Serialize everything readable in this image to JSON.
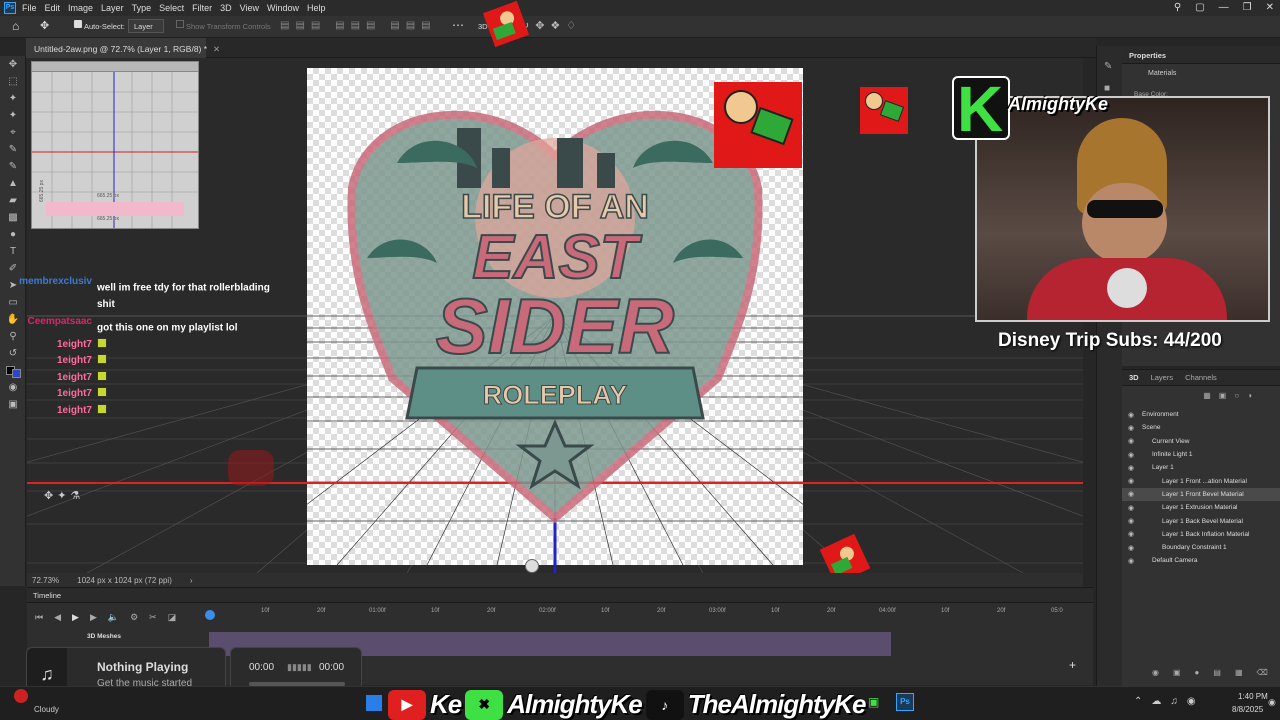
{
  "menubar": {
    "app_icon": "Ps",
    "items": [
      "File",
      "Edit",
      "Image",
      "Layer",
      "Type",
      "Select",
      "Filter",
      "3D",
      "View",
      "Window",
      "Help"
    ]
  },
  "options": {
    "auto_select_label": "Auto-Select:",
    "auto_select_value": "Layer",
    "show_transform": "Show Transform Controls",
    "mode_3d_label": "3D Mode:"
  },
  "document": {
    "tab_title": "Untitled-2aw.png @ 72.7% (Layer 1, RGB/8) *",
    "zoom": "72.73%",
    "size": "1024 px x 1024 px (72 ppi)",
    "ruler_text_top": "665.25 px",
    "ruler_text_bottom": "665.25 px",
    "ruler_text_side": "665.25 px"
  },
  "logo": {
    "line1": "LIFE OF AN",
    "line2": "EAST",
    "line3": "SIDER",
    "line4": "ROLEPLAY"
  },
  "chat": [
    {
      "user": "membrexclusiv",
      "text": "well im free tdy for that rollerblading",
      "user_color": "#3a7bd5"
    },
    {
      "user": "",
      "text": "shit",
      "user_color": "#3a7bd5"
    },
    {
      "user": "Ceempatsaac",
      "text": "got this one on my playlist lol",
      "user_color": "#e0246a"
    },
    {
      "user": "1eight7",
      "text": "",
      "user_color": "#ff6b9d"
    },
    {
      "user": "1eight7",
      "text": "",
      "user_color": "#ff6b9d"
    },
    {
      "user": "1eight7",
      "text": "",
      "user_color": "#ff6b9d"
    },
    {
      "user": "1eight7",
      "text": "",
      "user_color": "#ff6b9d"
    },
    {
      "user": "1eight7",
      "text": "",
      "user_color": "#ff6b9d"
    }
  ],
  "overlay": {
    "brand": "AlmightyKe",
    "brand_letter": "K",
    "subs": "Disney Trip Subs: 44/200"
  },
  "properties": {
    "title": "Properties",
    "materials": "Materials",
    "base_color": "Base Color:"
  },
  "panel3d": {
    "tabs": [
      "3D",
      "Layers",
      "Channels"
    ],
    "items": [
      {
        "label": "Environment",
        "indent": 0
      },
      {
        "label": "Scene",
        "indent": 0
      },
      {
        "label": "Current View",
        "indent": 1
      },
      {
        "label": "Infinite Light 1",
        "indent": 1
      },
      {
        "label": "Layer 1",
        "indent": 1
      },
      {
        "label": "Layer 1 Front ...ation Material",
        "indent": 2
      },
      {
        "label": "Layer 1 Front Bevel Material",
        "indent": 2
      },
      {
        "label": "Layer 1 Extrusion Material",
        "indent": 2
      },
      {
        "label": "Layer 1 Back Bevel Material",
        "indent": 2
      },
      {
        "label": "Layer 1 Back Inflation Material",
        "indent": 2
      },
      {
        "label": "Boundary Constraint 1",
        "indent": 2
      },
      {
        "label": "Default Camera",
        "indent": 1
      }
    ]
  },
  "timeline": {
    "title": "Timeline",
    "track": "3D Meshes",
    "ticks": [
      "10f",
      "20f",
      "01:00f",
      "10f",
      "20f",
      "02:00f",
      "10f",
      "20f",
      "03:00f",
      "10f",
      "20f",
      "04:00f",
      "10f",
      "20f",
      "05:0"
    ]
  },
  "music": {
    "title": "Nothing Playing",
    "subtitle": "Get the music started",
    "time_start": "00:00",
    "time_end": "00:00"
  },
  "taskbar": {
    "weather": "Cloudy",
    "time": "1:40 PM",
    "date": "8/8/2025",
    "social_short": "Ke",
    "social_name": "AlmightyKe",
    "social_tiktok": "TheAlmightyKe"
  }
}
